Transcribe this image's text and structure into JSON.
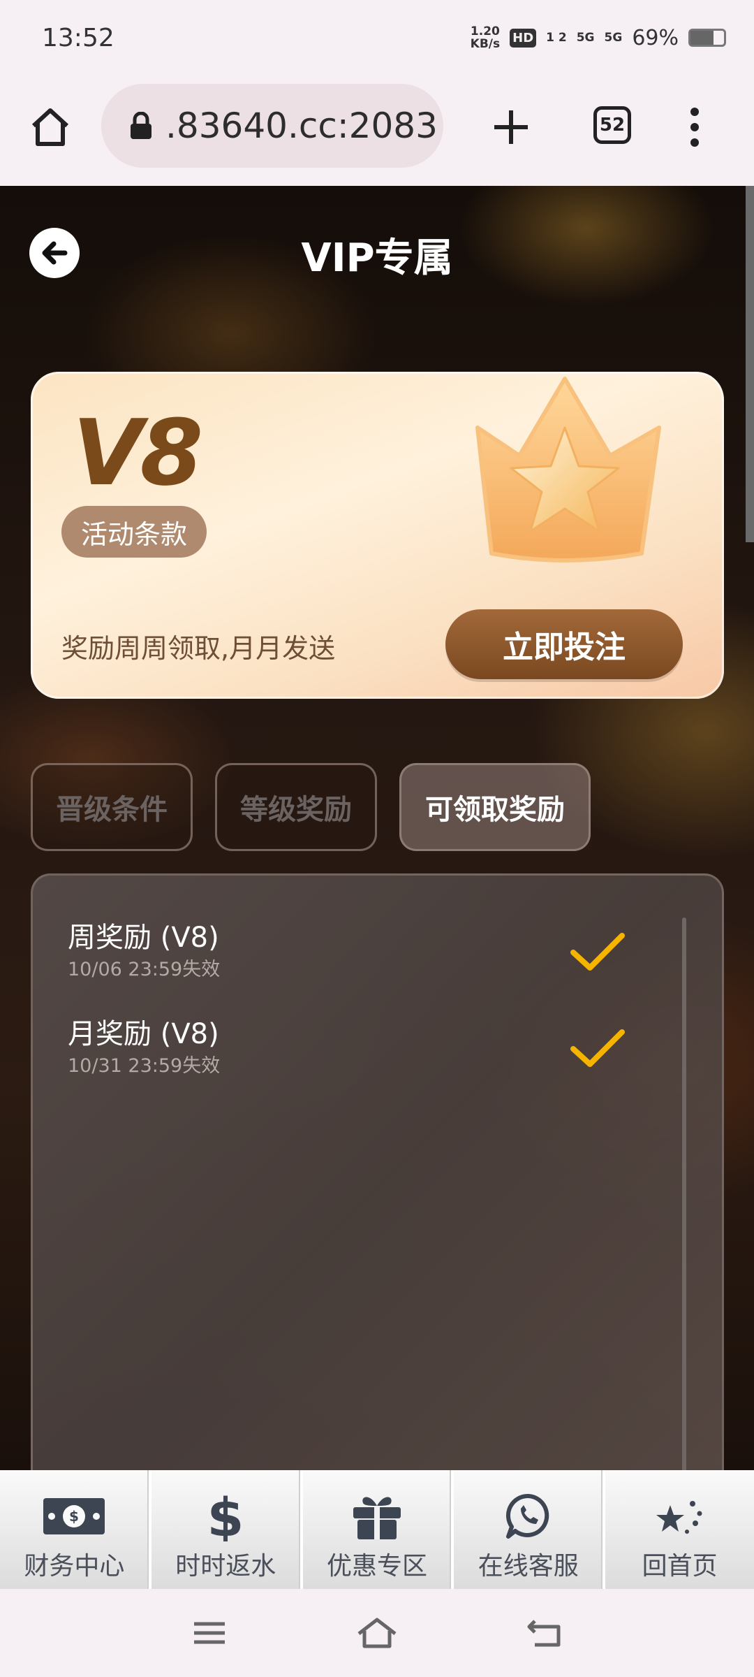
{
  "status_bar": {
    "time": "13:52",
    "speed_value": "1.20",
    "speed_unit": "KB/s",
    "hd_label": "HD",
    "hd_sub": "1 2",
    "net1": "5G",
    "net2": "5G",
    "battery": "69%",
    "battery_level": 0.69
  },
  "browser": {
    "url": ".83640.cc:2083",
    "tab_count": "52"
  },
  "page": {
    "title": "VIP专属"
  },
  "vip_card": {
    "level": "V8",
    "terms_label": "活动条款",
    "reward_note": "奖励周周领取,月月发送",
    "bet_button": "立即投注"
  },
  "tabs": [
    {
      "label": "晋级条件",
      "active": false
    },
    {
      "label": "等级奖励",
      "active": false
    },
    {
      "label": "可领取奖励",
      "active": true
    }
  ],
  "rewards": [
    {
      "title": "周奖励 (V8)",
      "expiry": "10/06 23:59失效",
      "claimed": true
    },
    {
      "title": "月奖励 (V8)",
      "expiry": "10/31 23:59失效",
      "claimed": true
    }
  ],
  "bottom_nav": [
    {
      "label": "财务中心",
      "icon": "money-bill-icon"
    },
    {
      "label": "时时返水",
      "icon": "dollar-icon"
    },
    {
      "label": "优惠专区",
      "icon": "gift-icon"
    },
    {
      "label": "在线客服",
      "icon": "whatsapp-icon"
    },
    {
      "label": "回首页",
      "icon": "stars-icon"
    }
  ],
  "colors": {
    "accent_brown": "#7a4820",
    "check_gold": "#f5b400"
  }
}
